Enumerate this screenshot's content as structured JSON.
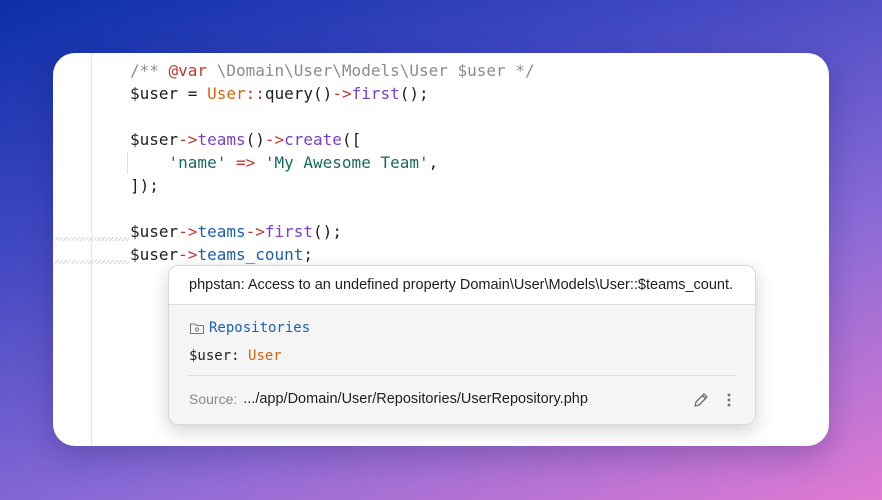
{
  "code": {
    "lines": [
      {
        "doc_open": "/** ",
        "doc_tag": "@var",
        "doc_type": " \\Domain\\User\\Models\\User $user ",
        "doc_close": "*/"
      },
      {
        "var": "$user",
        "eq": " = ",
        "cls": "User",
        "dcolon": "::",
        "method": "query",
        "paren": "()",
        "arrow": "->",
        "method2": "first",
        "end": "();"
      },
      {},
      {
        "var": "$user",
        "arrow": "->",
        "prop": "teams",
        "paren": "()",
        "arrow2": "->",
        "method": "create",
        "end": "(["
      },
      {
        "indent": "    ",
        "key": "'name'",
        "arrow": " => ",
        "val": "'My Awesome Team'",
        "end": ","
      },
      {
        "text": "]);"
      },
      {},
      {
        "var": "$user",
        "arrow": "->",
        "prop": "teams",
        "arrow2": "->",
        "method": "first",
        "end": "();"
      },
      {
        "var": "$user",
        "arrow": "->",
        "prop": "teams_count",
        "end": ";"
      }
    ]
  },
  "popup": {
    "message": "phpstan: Access to an undefined property Domain\\User\\Models\\User::$teams_count.",
    "repo_link": "Repositories",
    "var_label": "$user: ",
    "var_type": "User",
    "source_label": "Source:",
    "source_path": ".../app/Domain/User/Repositories/UserRepository.php"
  },
  "icons": {
    "folder": "folder-icon",
    "edit": "pencil-icon",
    "more": "more-vertical-icon"
  },
  "colors": {
    "keyword": "#c7342c",
    "class": "#d9620b",
    "method": "#7a3fc4",
    "property": "#1c5fae",
    "string": "#1a6a60",
    "comment": "#8c8c8c"
  }
}
